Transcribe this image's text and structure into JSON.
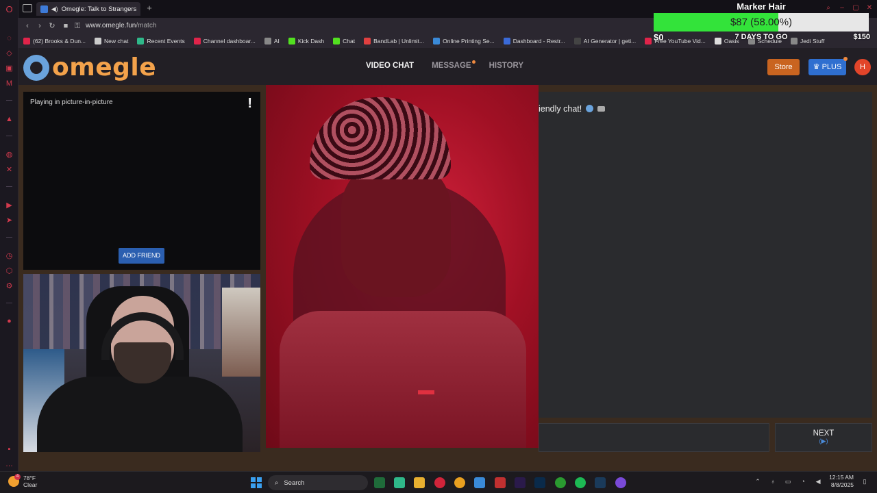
{
  "browser": {
    "tab_title": "Omegle: Talk to Strangers!",
    "new_tab_symbol": "+",
    "url_host": "www.omegle.fun",
    "url_path": "/match"
  },
  "bookmarks": [
    {
      "label": "(62) Brooks & Dun...",
      "color": "#e0244a"
    },
    {
      "label": "New chat",
      "color": "#cccccc"
    },
    {
      "label": "Recent Events",
      "color": "#2fb88a"
    },
    {
      "label": "Channel dashboar...",
      "color": "#e0244a"
    },
    {
      "label": "AI",
      "color": "#888888"
    },
    {
      "label": "Kick Dash",
      "color": "#52e020"
    },
    {
      "label": "Chat",
      "color": "#52e020"
    },
    {
      "label": "BandLab | Unlimit...",
      "color": "#e04040"
    },
    {
      "label": "Online Printing Se...",
      "color": "#3a8ad8"
    },
    {
      "label": "Dashboard - Restr...",
      "color": "#3a6ad8"
    },
    {
      "label": "AI Generator | geti...",
      "color": "#444444"
    },
    {
      "label": "Free YouTube Vid...",
      "color": "#e0244a"
    },
    {
      "label": "Oasis",
      "color": "#dddddd"
    },
    {
      "label": "Schedule",
      "color": "#888888"
    },
    {
      "label": "Jedi Stuff",
      "color": "#888888"
    }
  ],
  "goal": {
    "title": "Marker Hair",
    "amount_text": "$87 (58.00%)",
    "progress": 0.58,
    "min": "$0",
    "days_left": "7 DAYS TO GO",
    "max": "$150"
  },
  "site": {
    "logo_text": "omegle",
    "nav": [
      {
        "label": "VIDEO CHAT",
        "active": true
      },
      {
        "label": "MESSAGE",
        "active": false,
        "dot": true
      },
      {
        "label": "HISTORY",
        "active": false
      }
    ],
    "store_label": "Store",
    "plus_label": "PLUS",
    "avatar_letter": "H"
  },
  "pip": {
    "text": "Playing in picture-in-picture",
    "report_symbol": "!",
    "add_friend_label": "ADD FRIEND"
  },
  "chat": {
    "welcome_text": "iendly chat!",
    "next_label": "NEXT",
    "next_key": "(▶)"
  },
  "taskbar": {
    "temp": "78°F",
    "condition": "Clear",
    "weather_badge": "4",
    "search_label": "Search",
    "time": "12:15 AM",
    "date": "8/8/2025"
  }
}
